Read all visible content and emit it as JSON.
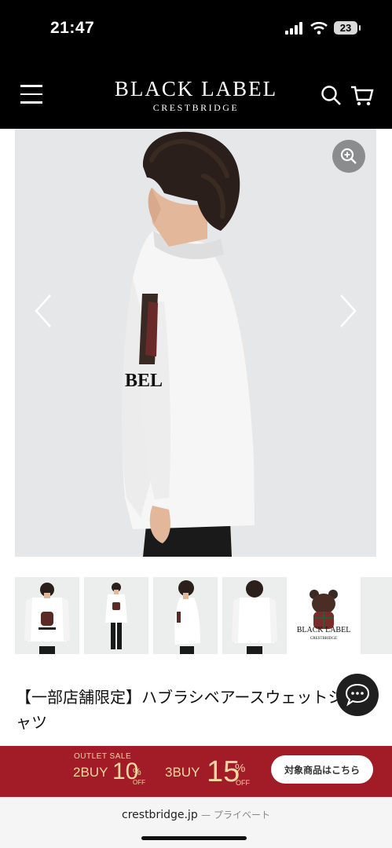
{
  "status_bar": {
    "time": "21:47",
    "battery": "23"
  },
  "header": {
    "logo_main": "BLACK LABEL",
    "logo_sub": "CRESTBRIDGE"
  },
  "product": {
    "shirt_print": "BEL",
    "title_line1": "【一部店舗限定】ハブラシベアースウェットシ",
    "title_line2": "ャツ",
    "thumbnail_print": "BLACK LABEL",
    "thumbnail_print_sub": "CRESTBRIDGE"
  },
  "banner": {
    "outlet_label": "OUTLET SALE",
    "buy2": "2BUY",
    "pct10": "10",
    "pct_symbol": "%",
    "off": "OFF",
    "buy3": "3BUY",
    "pct15": "15",
    "cta": "対象商品はこちら"
  },
  "footer": {
    "domain": "crestbridge.jp",
    "note": "— プライベート"
  }
}
